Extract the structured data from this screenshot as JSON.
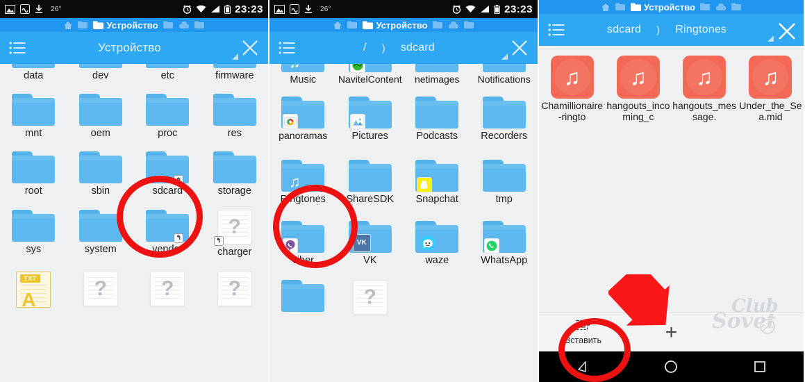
{
  "status_bar": {
    "icons": [
      "image-icon",
      "screenshot-icon",
      "download-icon"
    ],
    "temperature": "26°",
    "right_icons": [
      "alarm-icon",
      "wifi-icon",
      "signal-icon",
      "battery-icon"
    ],
    "clock": "23:23"
  },
  "tab_strip": {
    "active_tab_label": "Устройство",
    "icons": [
      "home-icon",
      "device-tab-icon",
      "device-tab-icon",
      "device-tab-icon",
      "cloud-tab-icon",
      "device-tab-icon"
    ]
  },
  "panels": [
    {
      "id": "panel-device-root",
      "toolbar": {
        "menu_icon": "list-menu-icon",
        "crumbs": [
          "Устройство"
        ],
        "separator": "",
        "close_icon": "close-icon"
      },
      "rows": [
        {
          "clipped": true,
          "items": [
            {
              "name": "data",
              "type": "folder"
            },
            {
              "name": "dev",
              "type": "folder"
            },
            {
              "name": "etc",
              "type": "folder"
            },
            {
              "name": "firmware",
              "type": "folder"
            }
          ]
        },
        {
          "items": [
            {
              "name": "mnt",
              "type": "folder"
            },
            {
              "name": "oem",
              "type": "folder"
            },
            {
              "name": "proc",
              "type": "folder"
            },
            {
              "name": "res",
              "type": "folder"
            }
          ]
        },
        {
          "items": [
            {
              "name": "root",
              "type": "folder"
            },
            {
              "name": "sbin",
              "type": "folder"
            },
            {
              "name": "sdcard",
              "type": "folder",
              "badge": "shortcut",
              "highlighted": true
            },
            {
              "name": "storage",
              "type": "folder"
            }
          ]
        },
        {
          "items": [
            {
              "name": "sys",
              "type": "folder"
            },
            {
              "name": "system",
              "type": "folder"
            },
            {
              "name": "vendor",
              "type": "folder",
              "badge": "shortcut"
            },
            {
              "name": "charger",
              "type": "unknown-file",
              "badge": "shortcut"
            }
          ]
        },
        {
          "clipped_bottom": true,
          "items": [
            {
              "name": "",
              "type": "txt-file"
            },
            {
              "name": "",
              "type": "unknown-file"
            },
            {
              "name": "",
              "type": "unknown-file"
            },
            {
              "name": "",
              "type": "unknown-file"
            }
          ]
        }
      ]
    },
    {
      "id": "panel-sdcard",
      "toolbar": {
        "menu_icon": "list-menu-icon",
        "crumbs": [
          "/",
          "sdcard"
        ],
        "separator": ")",
        "close_icon": "close-icon"
      },
      "rows": [
        {
          "clipped": true,
          "items": [
            {
              "name": "Music",
              "type": "folder",
              "badge": "music"
            },
            {
              "name": "NavitelContent",
              "type": "folder",
              "badge": "navitel"
            },
            {
              "name": "netimages",
              "type": "folder"
            },
            {
              "name": "Notifications",
              "type": "folder"
            }
          ]
        },
        {
          "items": [
            {
              "name": "panoramas",
              "type": "folder",
              "badge": "camera"
            },
            {
              "name": "Pictures",
              "type": "folder",
              "badge": "pictures"
            },
            {
              "name": "Podcasts",
              "type": "folder"
            },
            {
              "name": "Recorders",
              "type": "folder"
            }
          ]
        },
        {
          "items": [
            {
              "name": "Ringtones",
              "type": "folder",
              "badge": "music",
              "highlighted": true
            },
            {
              "name": "ShareSDK",
              "type": "folder"
            },
            {
              "name": "Snapchat",
              "type": "folder",
              "badge": "snap"
            },
            {
              "name": "tmp",
              "type": "folder"
            }
          ]
        },
        {
          "items": [
            {
              "name": "viber",
              "type": "folder",
              "badge": "viber"
            },
            {
              "name": "VK",
              "type": "folder",
              "badge": "vk"
            },
            {
              "name": "waze",
              "type": "folder",
              "badge": "waze"
            },
            {
              "name": "WhatsApp",
              "type": "folder",
              "badge": "whatsapp"
            }
          ]
        },
        {
          "clipped_bottom": true,
          "items": [
            {
              "name": "",
              "type": "folder"
            },
            {
              "name": "",
              "type": "unknown-file"
            }
          ]
        }
      ]
    },
    {
      "id": "panel-ringtones",
      "toolbar": {
        "menu_icon": "list-menu-icon",
        "crumbs": [
          "sdcard",
          "Ringtones"
        ],
        "separator": ")",
        "close_icon": "close-icon"
      },
      "rows": [
        {
          "items": [
            {
              "name": "Chamillionaire-ringto",
              "type": "audio-file"
            },
            {
              "name": "hangouts_incoming_c",
              "type": "audio-file"
            },
            {
              "name": "hangouts_message.",
              "type": "audio-file"
            },
            {
              "name": "Under_the_Sea.mid",
              "type": "audio-file"
            }
          ]
        }
      ],
      "bottom_bar": {
        "paste_label": "Вставить",
        "paste_icon": "paste-icon",
        "add_icon": "plus-icon"
      },
      "nav_bar": {
        "back_icon": "back-triangle-icon",
        "home_icon": "home-circle-icon",
        "recents_icon": "recents-square-icon"
      }
    }
  ],
  "annotations": {
    "circle_color": "#ee1111",
    "arrow_color": "#fa1717",
    "circles": [
      "sdcard-folder",
      "ringtones-folder",
      "paste-button"
    ],
    "arrow_points_to": "paste-button"
  },
  "watermark": {
    "line1": "Sovet",
    "line2": "Club",
    "symbol": "no-entry-icon"
  }
}
